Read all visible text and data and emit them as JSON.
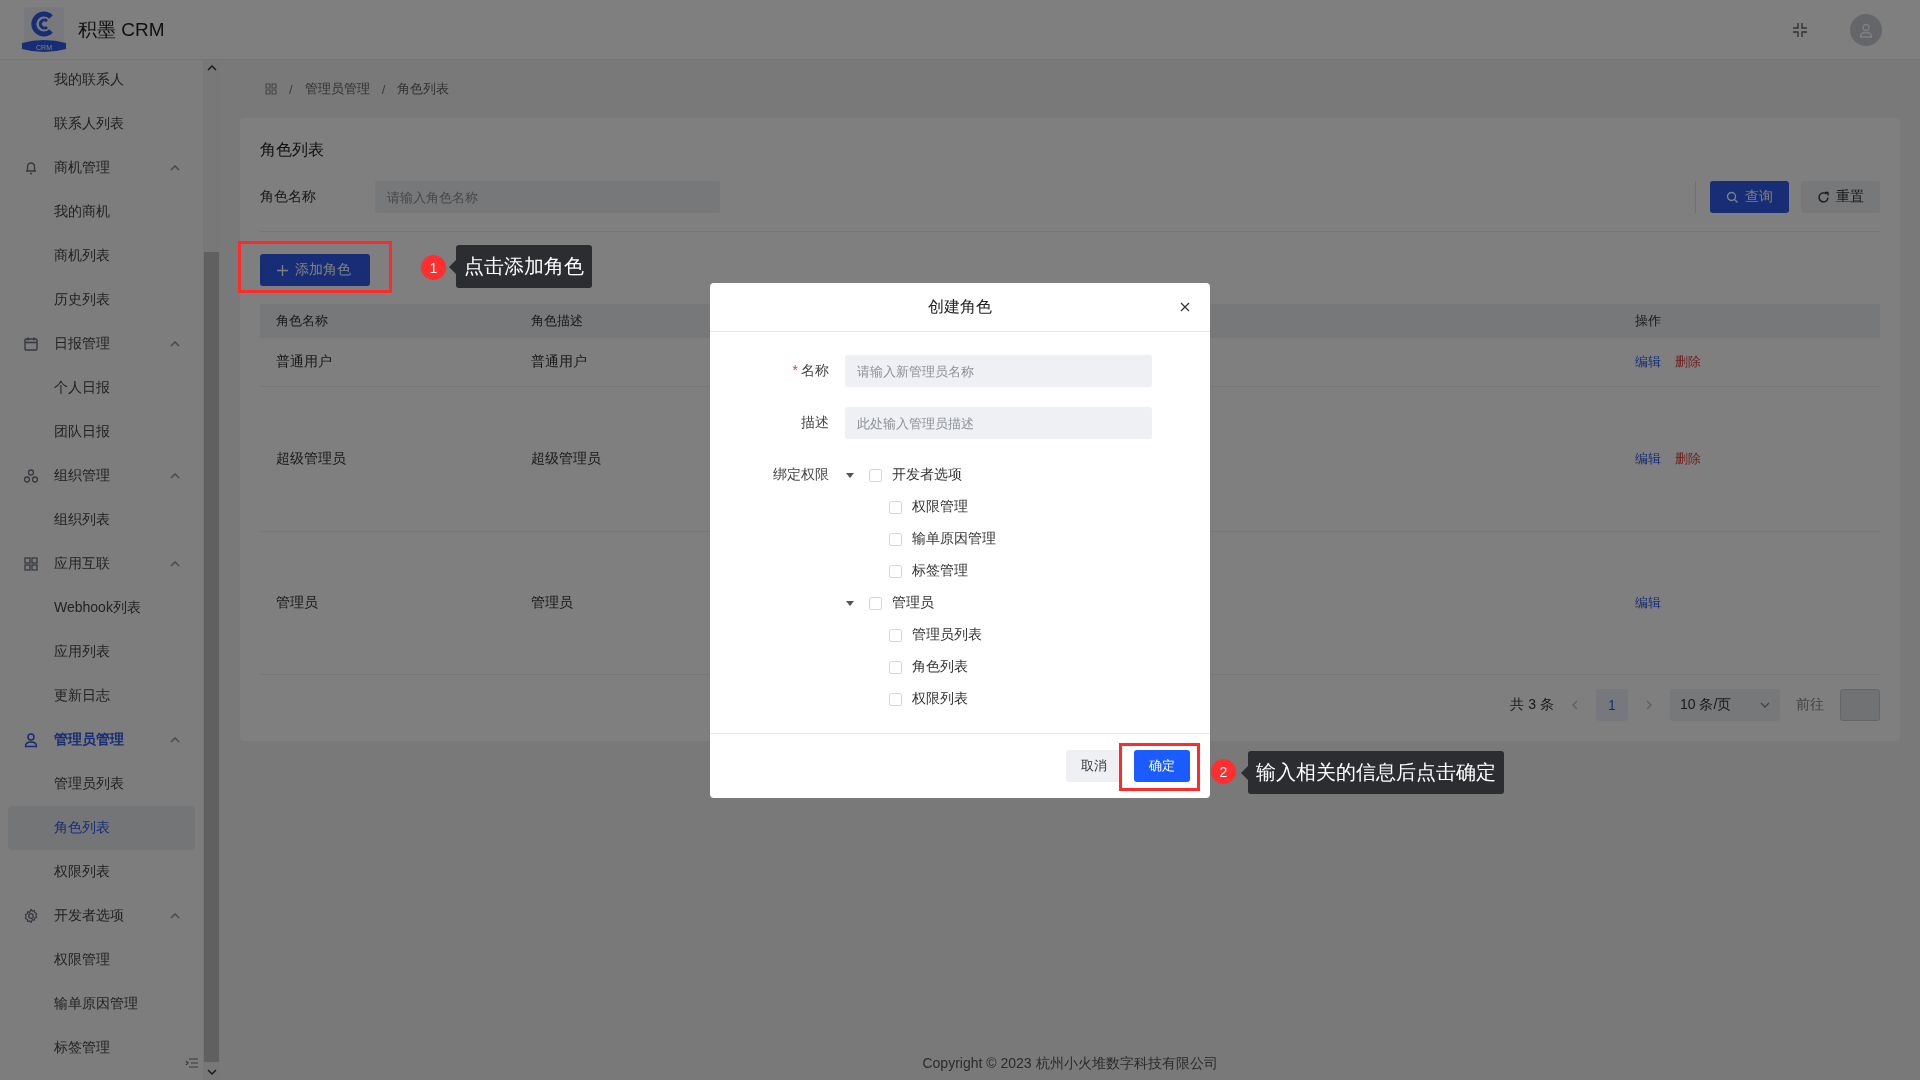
{
  "header": {
    "logo_text": "CRM",
    "title": "积墨 CRM"
  },
  "sidebar": {
    "items": [
      {
        "kind": "fragment",
        "children": [
          {
            "label": "我的联系人",
            "selected": false
          },
          {
            "label": "联系人列表",
            "selected": false
          }
        ]
      },
      {
        "kind": "group",
        "label": "商机管理",
        "expanded": true,
        "selected": false,
        "children": [
          {
            "label": "我的商机",
            "selected": false
          },
          {
            "label": "商机列表",
            "selected": false
          },
          {
            "label": "历史列表",
            "selected": false
          }
        ]
      },
      {
        "kind": "group",
        "label": "日报管理",
        "expanded": true,
        "selected": false,
        "children": [
          {
            "label": "个人日报",
            "selected": false
          },
          {
            "label": "团队日报",
            "selected": false
          }
        ]
      },
      {
        "kind": "group",
        "label": "组织管理",
        "expanded": true,
        "selected": false,
        "children": [
          {
            "label": "组织列表",
            "selected": false
          }
        ]
      },
      {
        "kind": "group",
        "label": "应用互联",
        "expanded": true,
        "selected": false,
        "children": [
          {
            "label": "Webhook列表",
            "selected": false
          },
          {
            "label": "应用列表",
            "selected": false
          },
          {
            "label": "更新日志",
            "selected": false
          }
        ]
      },
      {
        "kind": "group",
        "label": "管理员管理",
        "expanded": true,
        "selected": true,
        "children": [
          {
            "label": "管理员列表",
            "selected": false
          },
          {
            "label": "角色列表",
            "selected": true
          },
          {
            "label": "权限列表",
            "selected": false
          }
        ]
      },
      {
        "kind": "group",
        "label": "开发者选项",
        "expanded": true,
        "selected": false,
        "children": [
          {
            "label": "权限管理",
            "selected": false
          },
          {
            "label": "输单原因管理",
            "selected": false
          },
          {
            "label": "标签管理",
            "selected": false
          }
        ]
      }
    ]
  },
  "breadcrumb": [
    {
      "kind": "separator",
      "text": "/"
    },
    {
      "kind": "link",
      "text": "管理员管理"
    },
    {
      "kind": "separator",
      "text": "/"
    },
    {
      "kind": "link",
      "text": "角色列表"
    }
  ],
  "card": {
    "title": "角色列表",
    "search": {
      "label": "角色名称",
      "placeholder": "请输入角色名称",
      "buttons": [
        "查询",
        "重置"
      ]
    },
    "add_button": "添加角色",
    "table": {
      "columns": [
        "角色名称",
        "角色描述",
        "操作"
      ],
      "rows": [
        {
          "name": "普通用户",
          "description": "普通用户",
          "actions": [
            {
              "kind": "edit",
              "label": "编辑"
            },
            {
              "kind": "delete",
              "label": "删除"
            }
          ]
        },
        {
          "name": "超级管理员",
          "description": "超级管理员",
          "actions": [
            {
              "kind": "edit",
              "label": "编辑"
            },
            {
              "kind": "delete",
              "label": "删除"
            }
          ]
        },
        {
          "name": "管理员",
          "description": "管理员",
          "actions": [
            {
              "kind": "edit",
              "label": "编辑"
            }
          ]
        }
      ]
    },
    "pagination": {
      "total": "共 3 条",
      "pages": [
        {
          "label": "1",
          "selected": true
        }
      ],
      "page_size": "10 条/页",
      "goto": "前往"
    }
  },
  "footer": "Copyright © 2023 杭州小火堆数字科技有限公司",
  "dialog": {
    "title": "创建角色",
    "fields": [
      {
        "label": "名称",
        "required_mark": "*",
        "placeholder": "请输入新管理员名称"
      },
      {
        "label": "描述",
        "placeholder": "此处输入管理员描述"
      }
    ],
    "tree_label": "绑定权限",
    "tree": [
      {
        "label": "开发者选项",
        "expanded": true,
        "checked": false,
        "children": [
          {
            "label": "权限管理",
            "checked": false
          },
          {
            "label": "输单原因管理",
            "checked": false
          },
          {
            "label": "标签管理",
            "checked": false
          }
        ]
      },
      {
        "label": "管理员",
        "expanded": true,
        "checked": false,
        "children": [
          {
            "label": "管理员列表",
            "checked": false
          },
          {
            "label": "角色列表",
            "checked": false
          },
          {
            "label": "权限列表",
            "checked": false
          }
        ]
      }
    ],
    "buttons": [
      {
        "kind": "cancel",
        "label": "取消"
      },
      {
        "kind": "confirm",
        "label": "确定"
      }
    ]
  },
  "annotations": [
    {
      "number": "1",
      "text": "点击添加角色"
    },
    {
      "number": "2",
      "text": "输入相关的信息后点击确定"
    }
  ]
}
